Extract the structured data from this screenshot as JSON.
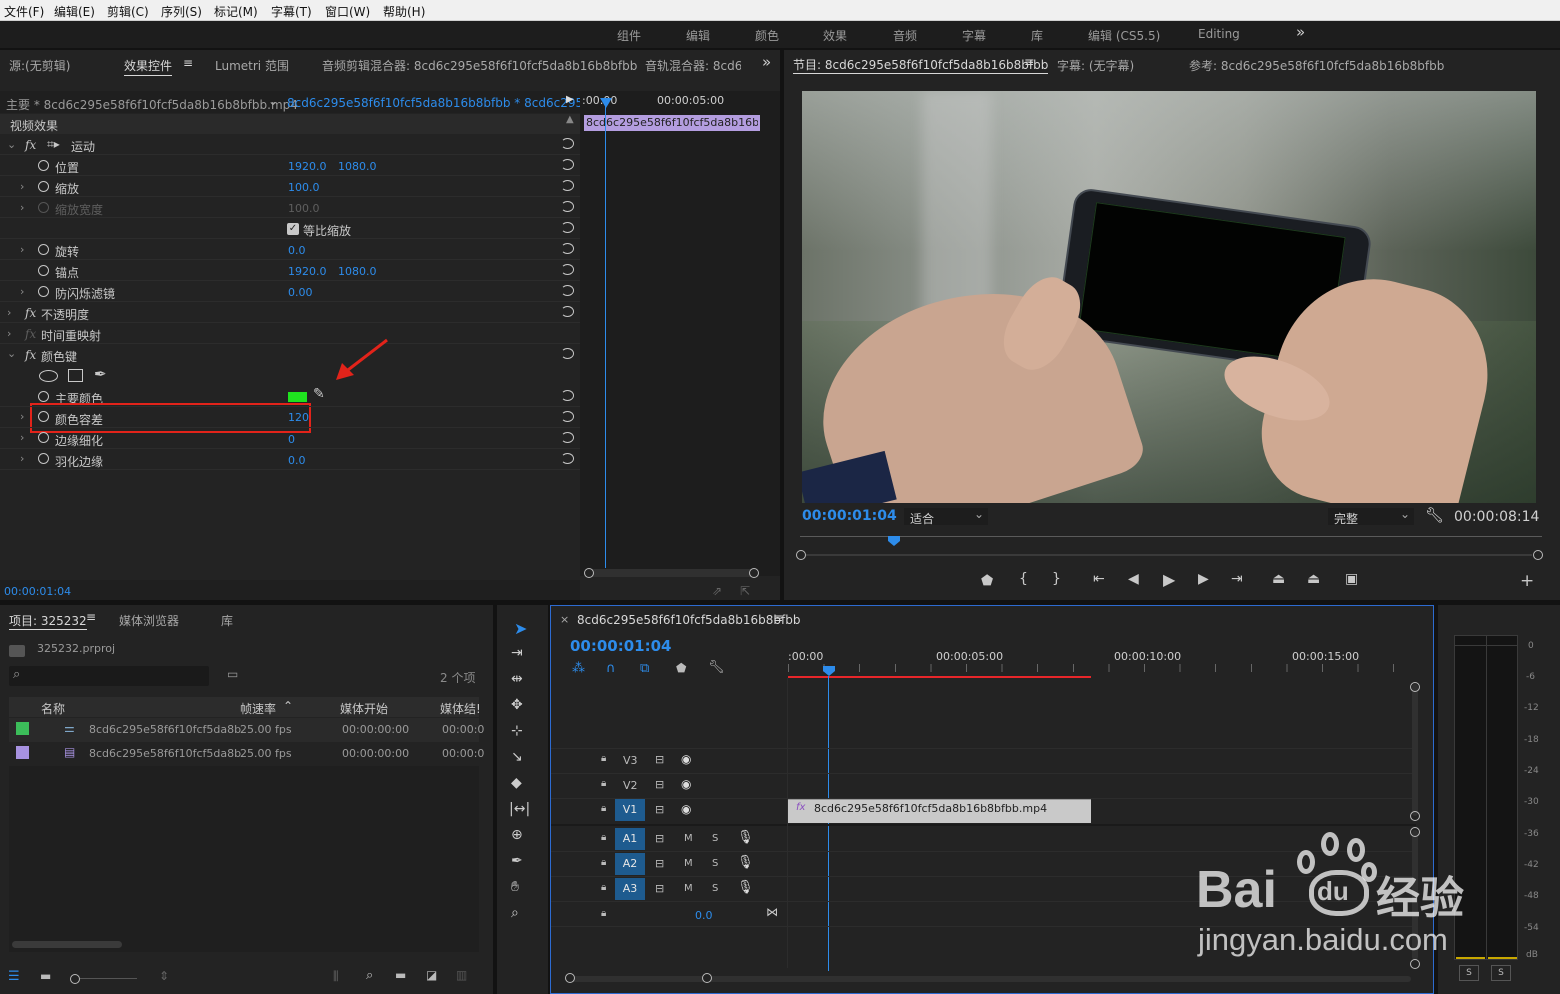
{
  "menu": [
    "文件(F)",
    "编辑(E)",
    "剪辑(C)",
    "序列(S)",
    "标记(M)",
    "字幕(T)",
    "窗口(W)",
    "帮助(H)"
  ],
  "workspaces": [
    "组件",
    "编辑",
    "颜色",
    "效果",
    "音频",
    "字幕",
    "库",
    "编辑 (CS5.5)",
    "Editing"
  ],
  "ws_more": "»",
  "left_tabs": {
    "source": "源:(无剪辑)",
    "effect_controls": "效果控件",
    "lumetri": "Lumetri 范围",
    "audio_clip_mixer": "音频剪辑混合器: 8cd6c295e58f6f10fcf5da8b16b8bfbb",
    "audio_track_mixer": "音轨混合器: 8cd6",
    "more": "»"
  },
  "ec": {
    "master": "主要 * 8cd6c295e58f6f10fcf5da8b16b8bfbb.mp4",
    "seq": "8cd6c295e58f6f10fcf5da8b16b8bfbb * 8cd6c295e...",
    "timecode_left": ":00:00",
    "timecode_right": "00:00:05:00",
    "clip_label": "8cd6c295e58f6f10fcf5da8b16b8bf",
    "video_effects": "视频效果",
    "fx": "fx",
    "motion": "运动",
    "position": "位置",
    "position_x": "1920.0",
    "position_y": "1080.0",
    "scale": "缩放",
    "scale_v": "100.0",
    "scale_width": "缩放宽度",
    "scale_width_v": "100.0",
    "uniform": "等比缩放",
    "rotation": "旋转",
    "rotation_v": "0.0",
    "anchor": "锚点",
    "anchor_x": "1920.0",
    "anchor_y": "1080.0",
    "flicker": "防闪烁滤镜",
    "flicker_v": "0.00",
    "opacity": "不透明度",
    "time_remap": "时间重映射",
    "color_key": "颜色键",
    "key_color": "主要颜色",
    "key_color_swatch": "#1fe31f",
    "tolerance": "颜色容差",
    "tolerance_v": "120",
    "edge_thin": "边缘细化",
    "edge_thin_v": "0",
    "feather": "羽化边缘",
    "feather_v": "0.0",
    "footer_tc": "00:00:01:04"
  },
  "program": {
    "tab": "节目: 8cd6c295e58f6f10fcf5da8b16b8bfbb",
    "captions": "字幕: (无字幕)",
    "reference": "参考: 8cd6c295e58f6f10fcf5da8b16b8bfbb",
    "tc": "00:00:01:04",
    "fit": "适合",
    "quality": "完整",
    "duration": "00:00:08:14"
  },
  "project": {
    "tab": "项目: 325232",
    "media_browser": "媒体浏览器",
    "library": "库",
    "file": "325232.prproj",
    "count": "2 个项",
    "col_name": "名称",
    "col_fps": "帧速率",
    "col_start": "媒体开始",
    "col_end": "媒体结!",
    "rows": [
      {
        "name": "8cd6c295e58f6f10fcf5da8b",
        "fps": "25.00 fps",
        "start": "00:00:00:00",
        "end": "00:00:0",
        "color": "#3cbd5a"
      },
      {
        "name": "8cd6c295e58f6f10fcf5da8b",
        "fps": "25.00 fps",
        "start": "00:00:00:00",
        "end": "00:00:0",
        "color": "#a792e0"
      }
    ]
  },
  "timeline": {
    "tab": "8cd6c295e58f6f10fcf5da8b16b8bfbb",
    "tc": "00:00:01:04",
    "ruler": [
      ":00:00",
      "00:00:05:00",
      "00:00:10:00",
      "00:00:15:00"
    ],
    "tracks": [
      "V3",
      "V2",
      "V1",
      "A1",
      "A2",
      "A3"
    ],
    "m": "M",
    "s": "S",
    "clip": "8cd6c295e58f6f10fcf5da8b16b8bfbb.mp4",
    "master_vol": "0.0"
  },
  "meter": {
    "labels": [
      "0",
      "-6",
      "-12",
      "-18",
      "-24",
      "-30",
      "-36",
      "-42",
      "-48",
      "-54",
      "dB"
    ],
    "s": "S"
  },
  "watermark": {
    "brand": "Bai",
    "paw": "du",
    "cn": "经验",
    "url": "jingyan.baidu.com"
  }
}
